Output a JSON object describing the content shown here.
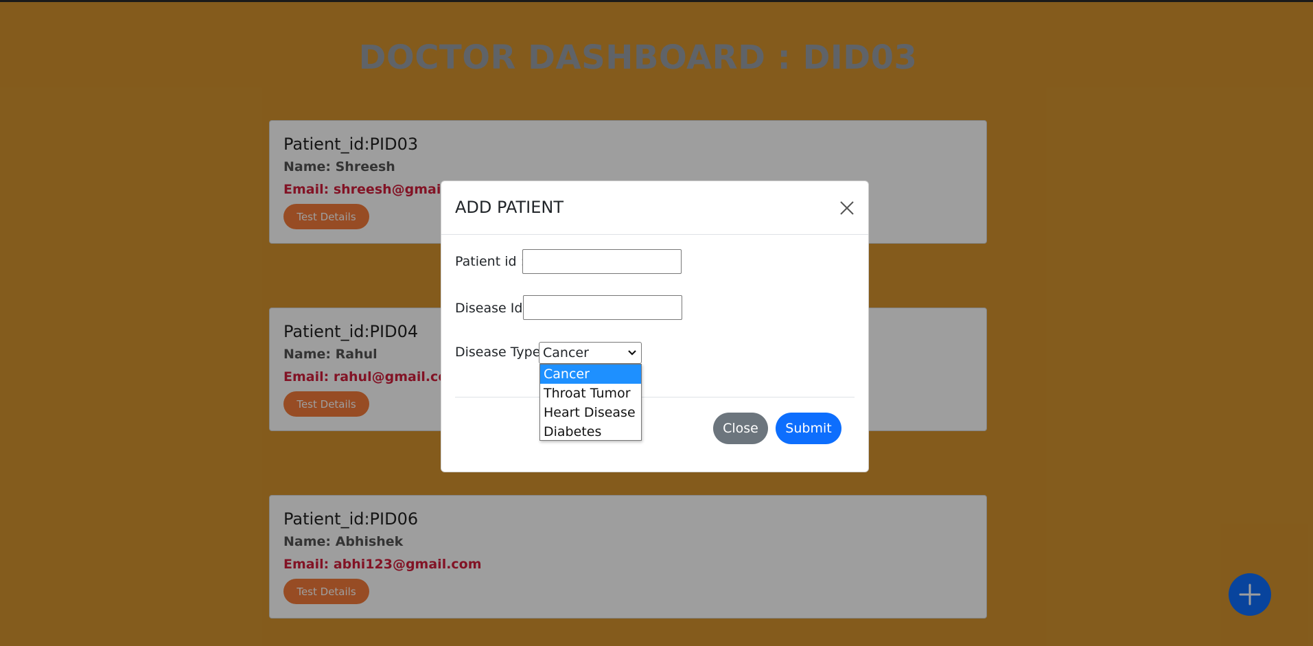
{
  "page": {
    "title": "DOCTOR DASHBOARD : DID03"
  },
  "patients": [
    {
      "pid": "Patient_id:PID03",
      "name": "Name: Shreesh",
      "email": "Email: shreesh@gmail.com",
      "button": "Test Details"
    },
    {
      "pid": "Patient_id:PID04",
      "name": "Name: Rahul",
      "email": "Email: rahul@gmail.com",
      "button": "Test Details"
    },
    {
      "pid": "Patient_id:PID06",
      "name": "Name: Abhishek",
      "email": "Email: abhi123@gmail.com",
      "button": "Test Details"
    }
  ],
  "fab": {
    "icon": "plus-icon"
  },
  "modal": {
    "title": "ADD PATIENT",
    "close_icon": "close-icon",
    "fields": {
      "patient_id_label": "Patient id :",
      "patient_id_value": "",
      "disease_id_label": "Disease Id:",
      "disease_id_value": "",
      "disease_type_label": "Disease Type:",
      "disease_type_selected": "Cancer",
      "disease_type_options": [
        "Cancer",
        "Throat Tumor",
        "Heart Disease",
        "Diabetes"
      ]
    },
    "buttons": {
      "close": "Close",
      "submit": "Submit"
    }
  },
  "colors": {
    "background": "#d5942e",
    "accent": "#0d6efd",
    "email": "#d21f3c",
    "test_button": "#f47b3a",
    "close_button": "#6c757d"
  }
}
